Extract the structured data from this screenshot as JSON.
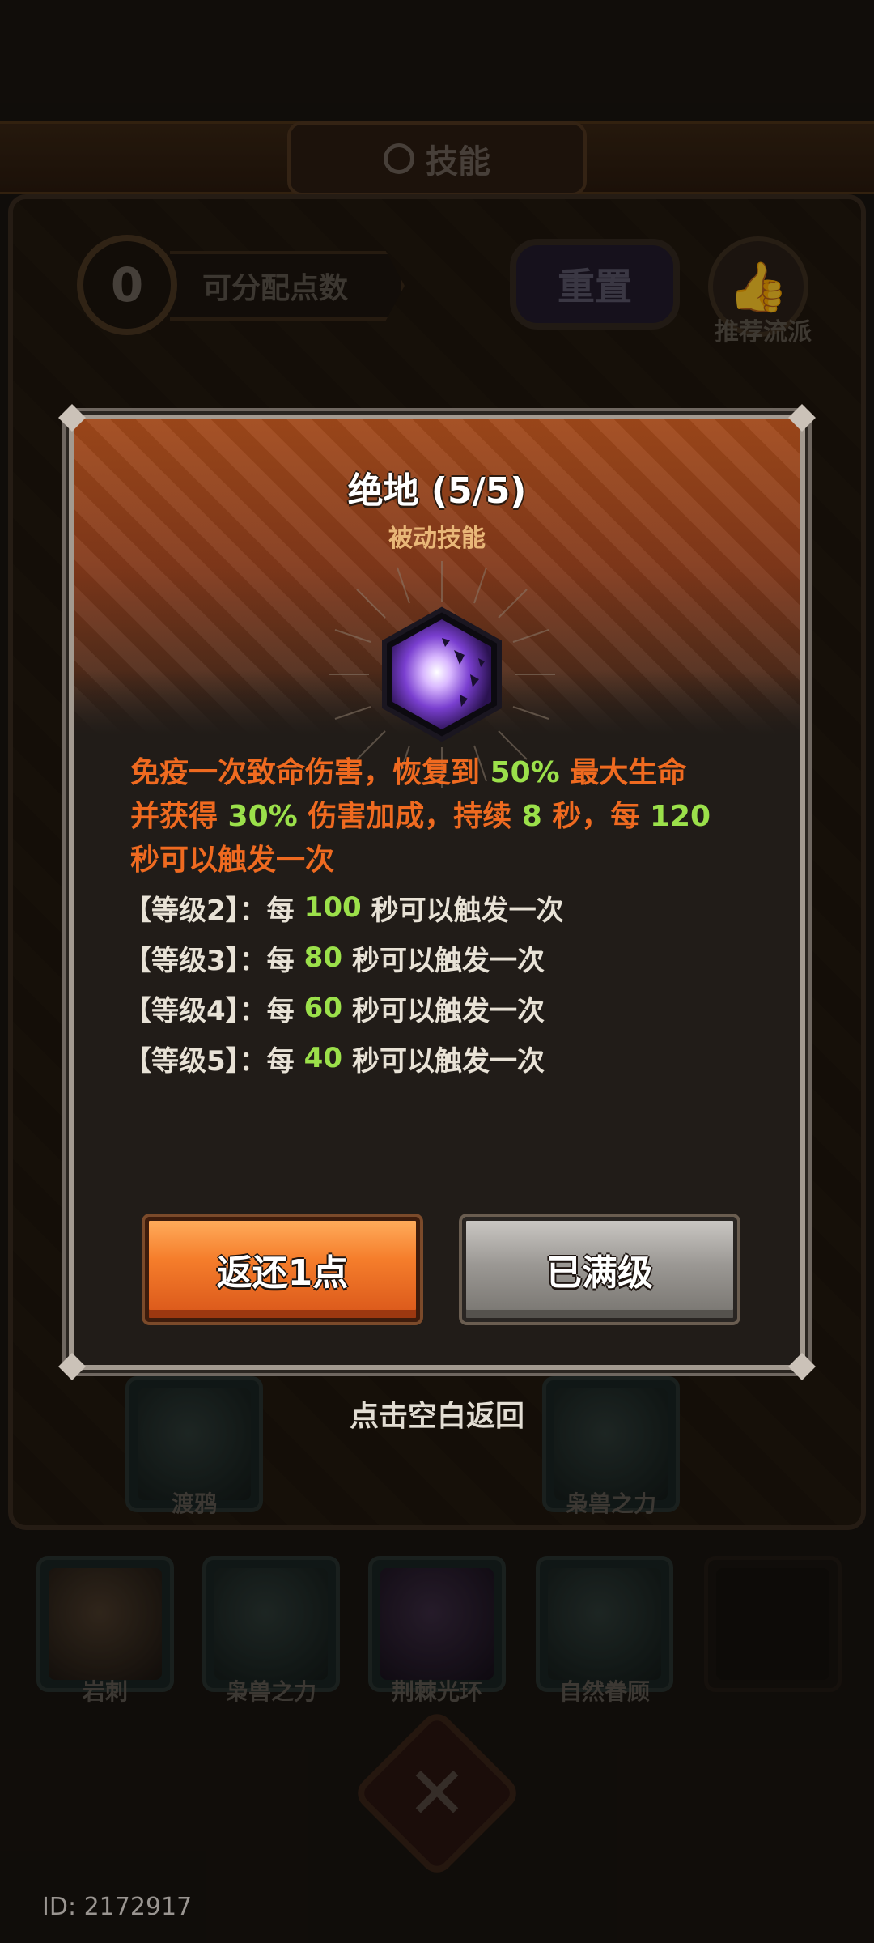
{
  "background": {
    "title": "技能",
    "points_value": "0",
    "points_label": "可分配点数",
    "reset_label": "重置",
    "recommend_label": "推荐流派",
    "skill_slots_row1": [
      "渡鸦",
      "枭兽之力"
    ],
    "skill_slots_row2": [
      "岩刺",
      "枭兽之力",
      "荆棘光环",
      "自然眷顾"
    ]
  },
  "dialog": {
    "title": "绝地 (5/5)",
    "subtitle": "被动技能",
    "icon": "shatter-burst-icon",
    "description": {
      "p1": "免疫一次致命伤害，恢复到 ",
      "v1": "50%",
      "p2": " 最大生命",
      "p3": "并获得 ",
      "v2": "30%",
      "p4": " 伤害加成，持续 ",
      "v3": "8",
      "p5": " 秒，每 ",
      "v4": "120",
      "p6": "秒可以触发一次"
    },
    "levels": [
      {
        "label": "【等级2】：每",
        "value": "100",
        "suffix": "秒可以触发一次"
      },
      {
        "label": "【等级3】：每",
        "value": "80",
        "suffix": "秒可以触发一次"
      },
      {
        "label": "【等级4】：每",
        "value": "60",
        "suffix": "秒可以触发一次"
      },
      {
        "label": "【等级5】：每",
        "value": "40",
        "suffix": "秒可以触发一次"
      }
    ],
    "refund_button": "返还1点",
    "maxed_button": "已满级"
  },
  "tap_hint": "点击空白返回",
  "player_id": "ID: 2172917",
  "colors": {
    "accent_orange": "#ef6a20",
    "highlight_green": "#9be04a",
    "subtitle_gold": "#e9b778"
  }
}
